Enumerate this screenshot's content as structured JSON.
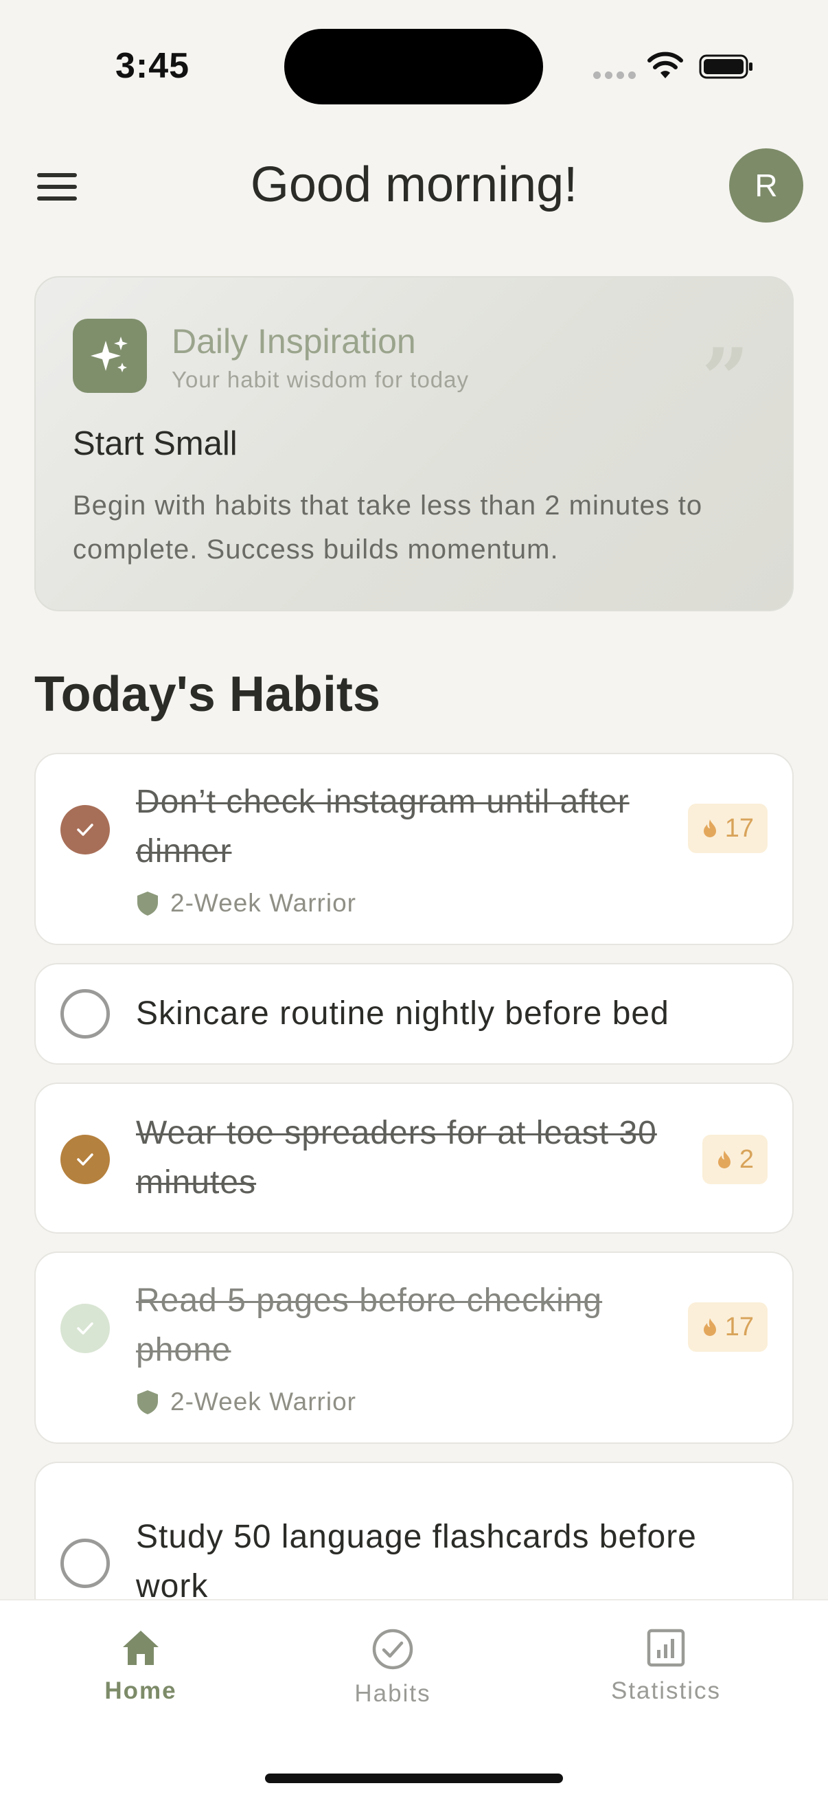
{
  "status_bar": {
    "time": "3:45"
  },
  "header": {
    "greeting": "Good morning!",
    "avatar_initial": "R"
  },
  "inspiration": {
    "title": "Daily Inspiration",
    "subtitle": "Your habit wisdom for today",
    "quote_mark": "”",
    "heading": "Start Small",
    "body": "Begin with habits that take less than 2 minutes to complete. Success builds momentum."
  },
  "section_title": "Today's Habits",
  "habits": [
    {
      "text": "Don’t check instagram until after dinner",
      "completed": true,
      "check_color": "#a86f58",
      "achievement": "2-Week Warrior",
      "streak": "17"
    },
    {
      "text": "Skincare routine nightly before bed",
      "completed": false
    },
    {
      "text": "Wear toe spreaders for at least 30 minutes",
      "completed": true,
      "check_color": "#b5813e",
      "streak": "2"
    },
    {
      "text": "Read 5 pages before checking phone",
      "completed": true,
      "check_color": "#d9e5d3",
      "achievement": "2-Week Warrior",
      "streak": "17"
    },
    {
      "text": "Study 50 language flashcards before work",
      "completed": false
    }
  ],
  "nav": {
    "home": "Home",
    "habits": "Habits",
    "statistics": "Statistics"
  },
  "colors": {
    "accent": "#7d8b69",
    "streak": "#d8a35a",
    "background": "#f5f4f0"
  }
}
